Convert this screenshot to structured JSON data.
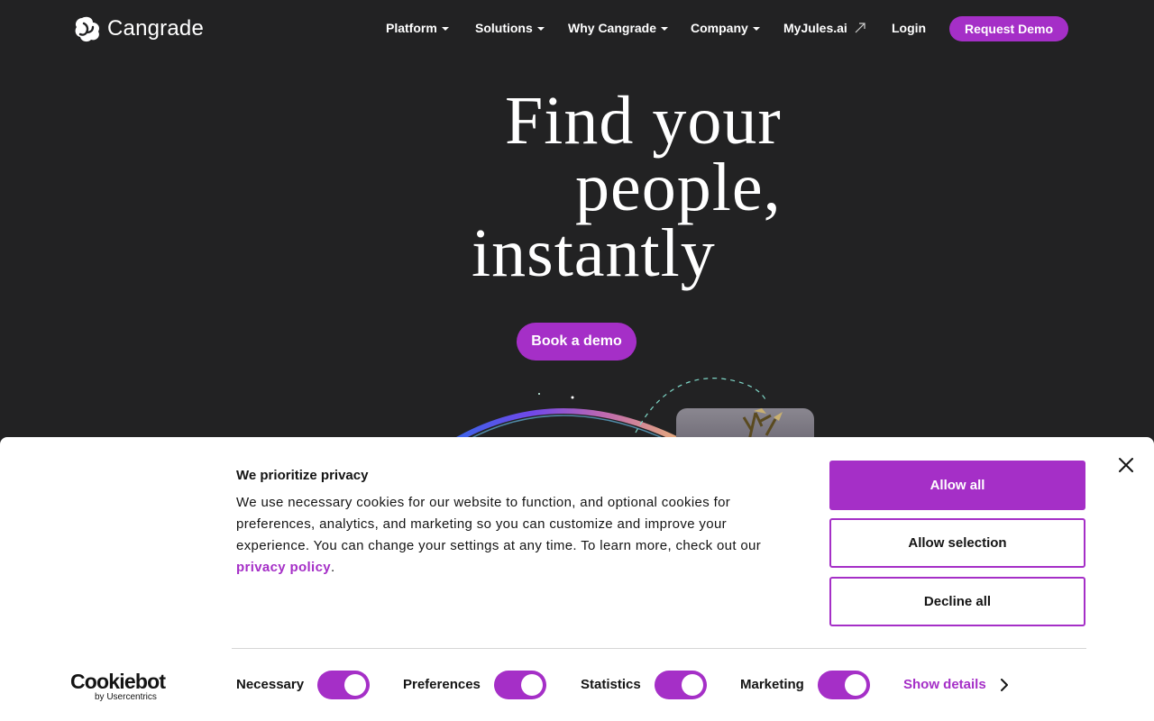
{
  "brand": {
    "name": "Cangrade"
  },
  "nav": {
    "items": [
      {
        "label": "Platform"
      },
      {
        "label": "Solutions"
      },
      {
        "label": "Why Cangrade"
      },
      {
        "label": "Company"
      },
      {
        "label": "MyJules.ai"
      }
    ],
    "login": "Login",
    "request_demo": "Request Demo",
    "external_icon": "arrow-up-right-icon"
  },
  "hero": {
    "line1": "Find your",
    "line2": "people,",
    "line3": "instantly",
    "cta": "Book a demo"
  },
  "cookie_banner": {
    "title": "We prioritize privacy",
    "body": "We use necessary cookies for our website to function, and optional cookies for preferences, analytics, and marketing so you can customize and improve your experience. You can change your settings at any time. To learn more, check out our",
    "link": "privacy policy",
    "period": ".",
    "buttons": {
      "allow_all": "Allow all",
      "allow_selection": "Allow selection",
      "decline_all": "Decline all"
    },
    "toggles": [
      {
        "label": "Necessary",
        "on": true
      },
      {
        "label": "Preferences",
        "on": true
      },
      {
        "label": "Statistics",
        "on": true
      },
      {
        "label": "Marketing",
        "on": true
      }
    ],
    "show_details": "Show details",
    "provider": {
      "name": "Cookiebot",
      "by": "by Usercentrics"
    }
  },
  "colors": {
    "accent": "#a52fc7",
    "background": "#222223",
    "banner": "#ffffff"
  }
}
